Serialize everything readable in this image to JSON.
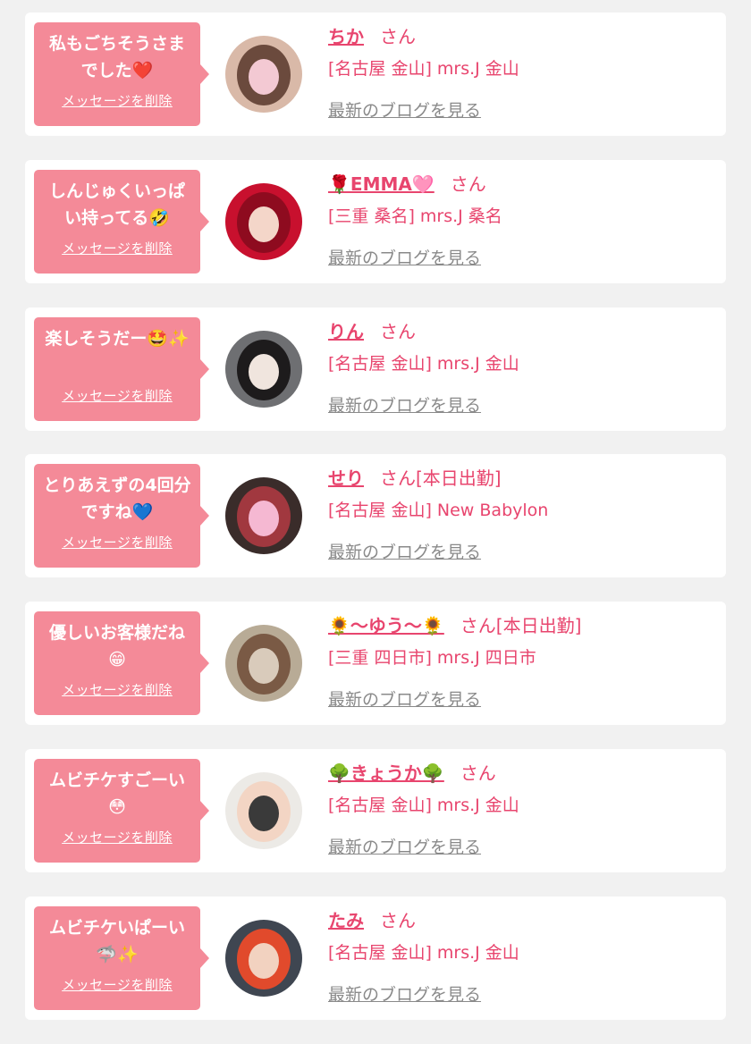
{
  "cards": [
    {
      "message": "私もごちそうさまでした❤️",
      "delete_label": "メッセージを削除",
      "name": "ちか",
      "suffix": "さん",
      "shop": "[名古屋 金山] mrs.J 金山",
      "blog_label": "最新のブログを見る",
      "avatar_colors": [
        "#d9b9a8",
        "#6b4a3d",
        "#f3c9d3"
      ]
    },
    {
      "message": "しんじゅくいっぱい持ってる🤣",
      "delete_label": "メッセージを削除",
      "name": "🌹EMMA🩷",
      "suffix": "さん",
      "shop": "[三重 桑名] mrs.J 桑名",
      "blog_label": "最新のブログを見る",
      "avatar_colors": [
        "#c8102e",
        "#8e0b1f",
        "#f4d6c9"
      ]
    },
    {
      "message": "楽しそうだー🤩✨",
      "delete_label": "メッセージを削除",
      "name": "りん",
      "suffix": "さん",
      "shop": "[名古屋 金山] mrs.J 金山",
      "blog_label": "最新のブログを見る",
      "avatar_colors": [
        "#6e6f72",
        "#1d1b1c",
        "#f0e5de"
      ]
    },
    {
      "message": "とりあえずの4回分ですね💙",
      "delete_label": "メッセージを削除",
      "name": "せり",
      "suffix": "さん[本日出勤]",
      "shop": "[名古屋 金山] New Babylon",
      "blog_label": "最新のブログを見る",
      "avatar_colors": [
        "#3a2c2a",
        "#a1383f",
        "#f5b8d2"
      ]
    },
    {
      "message": "優しいお客様だね😁",
      "delete_label": "メッセージを削除",
      "name": "🌻〜ゆう〜🌻",
      "suffix": "さん[本日出勤]",
      "shop": "[三重 四日市] mrs.J 四日市",
      "blog_label": "最新のブログを見る",
      "avatar_colors": [
        "#b8ab96",
        "#7a5a45",
        "#d9cbbb"
      ]
    },
    {
      "message": "ムビチケすごーい😳",
      "delete_label": "メッセージを削除",
      "name": "🌳きょうか🌳",
      "suffix": "さん",
      "shop": "[名古屋 金山] mrs.J 金山",
      "blog_label": "最新のブログを見る",
      "avatar_colors": [
        "#eceae6",
        "#f3d5c4",
        "#3a3a3a"
      ]
    },
    {
      "message": "ムビチケいぱーい🦈✨",
      "delete_label": "メッセージを削除",
      "name": "たみ",
      "suffix": "さん",
      "shop": "[名古屋 金山] mrs.J 金山",
      "blog_label": "最新のブログを見る",
      "avatar_colors": [
        "#3f4651",
        "#e14a2c",
        "#f2d2c0"
      ]
    }
  ]
}
